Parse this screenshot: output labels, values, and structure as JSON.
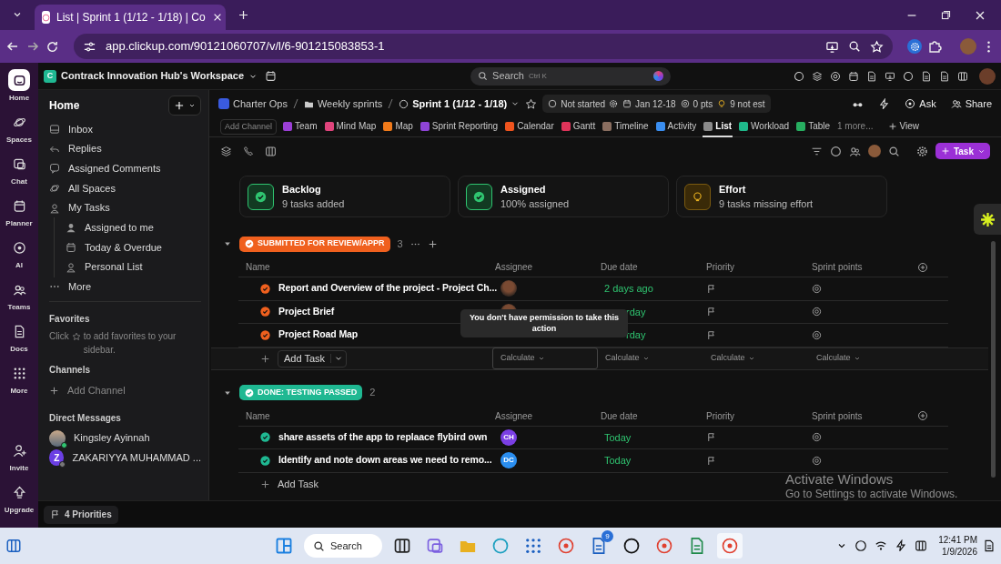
{
  "browser": {
    "tab_title": "List | Sprint 1 (1/12 - 1/18) | Co",
    "url": "app.clickup.com/90121060707/v/l/6-901215083853-1"
  },
  "workspace": {
    "initial": "C",
    "name": "Contrack Innovation Hub's Workspace",
    "search": "Search",
    "shortcut": "Ctrl K"
  },
  "rail": [
    {
      "label": "Home",
      "selected": true
    },
    {
      "label": "Spaces",
      "selected": false
    },
    {
      "label": "Chat",
      "selected": false
    },
    {
      "label": "Planner",
      "selected": false
    },
    {
      "label": "AI",
      "selected": false
    },
    {
      "label": "Teams",
      "selected": false
    },
    {
      "label": "Docs",
      "selected": false
    },
    {
      "label": "More",
      "selected": false
    }
  ],
  "rail_bottom": [
    "Invite",
    "Upgrade"
  ],
  "sidebar": {
    "title": "Home",
    "items": [
      {
        "label": "Inbox"
      },
      {
        "label": "Replies"
      },
      {
        "label": "Assigned Comments"
      },
      {
        "label": "All Spaces"
      },
      {
        "label": "My Tasks",
        "children": [
          {
            "label": "Assigned to me"
          },
          {
            "label": "Today & Overdue"
          },
          {
            "label": "Personal List"
          }
        ]
      },
      {
        "label": "More"
      }
    ],
    "favorites": {
      "heading": "Favorites",
      "hint_start": "Click",
      "hint_end": "to add favorites to your sidebar."
    },
    "channels": {
      "heading": "Channels",
      "add": "Add Channel"
    },
    "direct_messages": {
      "heading": "Direct Messages",
      "people": [
        {
          "name": "Kingsley Ayinnah",
          "kind": "photo",
          "online": true
        },
        {
          "name": "ZAKARIYYA MUHAMMAD ...",
          "kind": "initial",
          "initial": "Z",
          "online": false
        }
      ]
    }
  },
  "priorities": "4 Priorities",
  "header": {
    "breadcrumbs": [
      {
        "label": "Charter Ops"
      },
      {
        "label": "Weekly sprints"
      },
      {
        "label": "Sprint 1 (1/12 - 1/18)"
      }
    ],
    "status": "Not started",
    "dates": "Jan 12-18",
    "points": "0 pts",
    "estimate": "9 not est",
    "actions": [
      "Ask",
      "Share"
    ]
  },
  "views": {
    "add_channel": "Add Channel",
    "items": [
      {
        "label": "Team",
        "color": "#9b3fd6",
        "selected": false
      },
      {
        "label": "Mind Map",
        "color": "#e0447c",
        "selected": false
      },
      {
        "label": "Map",
        "color": "#f07a1a",
        "selected": false
      },
      {
        "label": "Sprint Reporting",
        "color": "#8e44d6",
        "selected": false
      },
      {
        "label": "Calendar",
        "color": "#f0541e",
        "selected": false
      },
      {
        "label": "Gantt",
        "color": "#e0345a",
        "selected": false
      },
      {
        "label": "Timeline",
        "color": "#8a6e60",
        "selected": false
      },
      {
        "label": "Activity",
        "color": "#3a8ef0",
        "selected": false
      },
      {
        "label": "List",
        "color": "#8a8a8a",
        "selected": true
      },
      {
        "label": "Workload",
        "color": "#1fb88a",
        "selected": false
      },
      {
        "label": "Table",
        "color": "#27ae60",
        "selected": false
      }
    ],
    "more": "1 more...",
    "add": "View"
  },
  "new_task": "Task",
  "cards": [
    {
      "title": "Backlog",
      "subtitle": "9 tasks added",
      "kind": "check"
    },
    {
      "title": "Assigned",
      "subtitle": "100% assigned",
      "kind": "check"
    },
    {
      "title": "Effort",
      "subtitle": "9 tasks missing effort",
      "kind": "effort"
    }
  ],
  "groups": [
    {
      "status": "SUBMITTED FOR REVIEW/APPR",
      "color": "#f0601e",
      "expanded": true,
      "count": "3",
      "columns": [
        "Name",
        "Assignee",
        "Due date",
        "Priority",
        "Sprint points"
      ],
      "tasks": [
        {
          "name": "Report and Overview of the project - Project Ch...",
          "assignee": {
            "kind": "photo"
          },
          "due": "2 days ago"
        },
        {
          "name": "Project Brief",
          "assignee": {
            "kind": "photo"
          },
          "due": "rday"
        },
        {
          "name": "Project Road Map",
          "due": "rday"
        }
      ],
      "add_task": "Add Task",
      "calculate": [
        "Calculate",
        "Calculate",
        "Calculate",
        "Calculate"
      ]
    },
    {
      "status": "DONE: TESTING PASSED",
      "color": "#1fb892",
      "expanded": true,
      "count": "2",
      "columns": [
        "Name",
        "Assignee",
        "Due date",
        "Priority",
        "Sprint points"
      ],
      "tasks": [
        {
          "name": "share assets of the app to replaace flybird own",
          "assignee": {
            "kind": "initials",
            "initials": "CH",
            "color": "#7b3fe4"
          },
          "due": "Today"
        },
        {
          "name": "Identify and note down areas we need to remo...",
          "assignee": {
            "kind": "initials",
            "initials": "DC",
            "color": "#2a8ef0"
          },
          "due": "Today"
        }
      ],
      "add_task": "Add Task"
    }
  ],
  "tooltip": "You don't have permission to take this action",
  "os_notice": {
    "title": "Activate Windows",
    "text": "Go to Settings to activate Windows."
  },
  "taskbar": {
    "search": "Search",
    "badge": "9",
    "time": "12:41 PM",
    "date": "1/9/2026"
  }
}
